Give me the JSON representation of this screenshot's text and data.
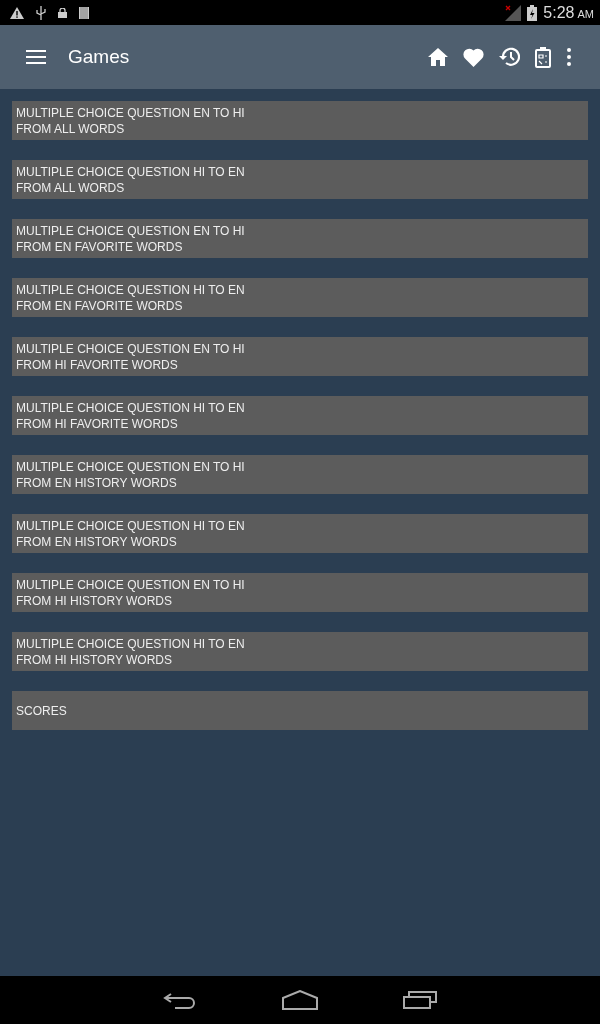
{
  "status_bar": {
    "time": "5:28",
    "ampm": "AM"
  },
  "app_bar": {
    "title": "Games"
  },
  "menu_items": [
    {
      "lines": [
        "MULTIPLE CHOICE QUESTION EN TO HI",
        "FROM ALL WORDS"
      ]
    },
    {
      "lines": [
        "MULTIPLE CHOICE QUESTION HI TO EN",
        "FROM ALL WORDS"
      ]
    },
    {
      "lines": [
        "MULTIPLE CHOICE QUESTION EN TO HI",
        "FROM EN FAVORITE WORDS"
      ]
    },
    {
      "lines": [
        "MULTIPLE CHOICE QUESTION HI TO EN",
        "FROM EN FAVORITE WORDS"
      ]
    },
    {
      "lines": [
        "MULTIPLE CHOICE QUESTION EN TO HI",
        "FROM HI FAVORITE WORDS"
      ]
    },
    {
      "lines": [
        "MULTIPLE CHOICE QUESTION HI TO EN",
        "FROM HI FAVORITE WORDS"
      ]
    },
    {
      "lines": [
        "MULTIPLE CHOICE QUESTION EN TO HI",
        "FROM EN HISTORY WORDS"
      ]
    },
    {
      "lines": [
        "MULTIPLE CHOICE QUESTION HI TO EN",
        "FROM EN HISTORY WORDS"
      ]
    },
    {
      "lines": [
        "MULTIPLE CHOICE QUESTION EN TO HI",
        "FROM HI HISTORY WORDS"
      ]
    },
    {
      "lines": [
        "MULTIPLE CHOICE QUESTION HI TO EN",
        "FROM HI HISTORY WORDS"
      ]
    },
    {
      "lines": [
        "SCORES"
      ]
    }
  ]
}
